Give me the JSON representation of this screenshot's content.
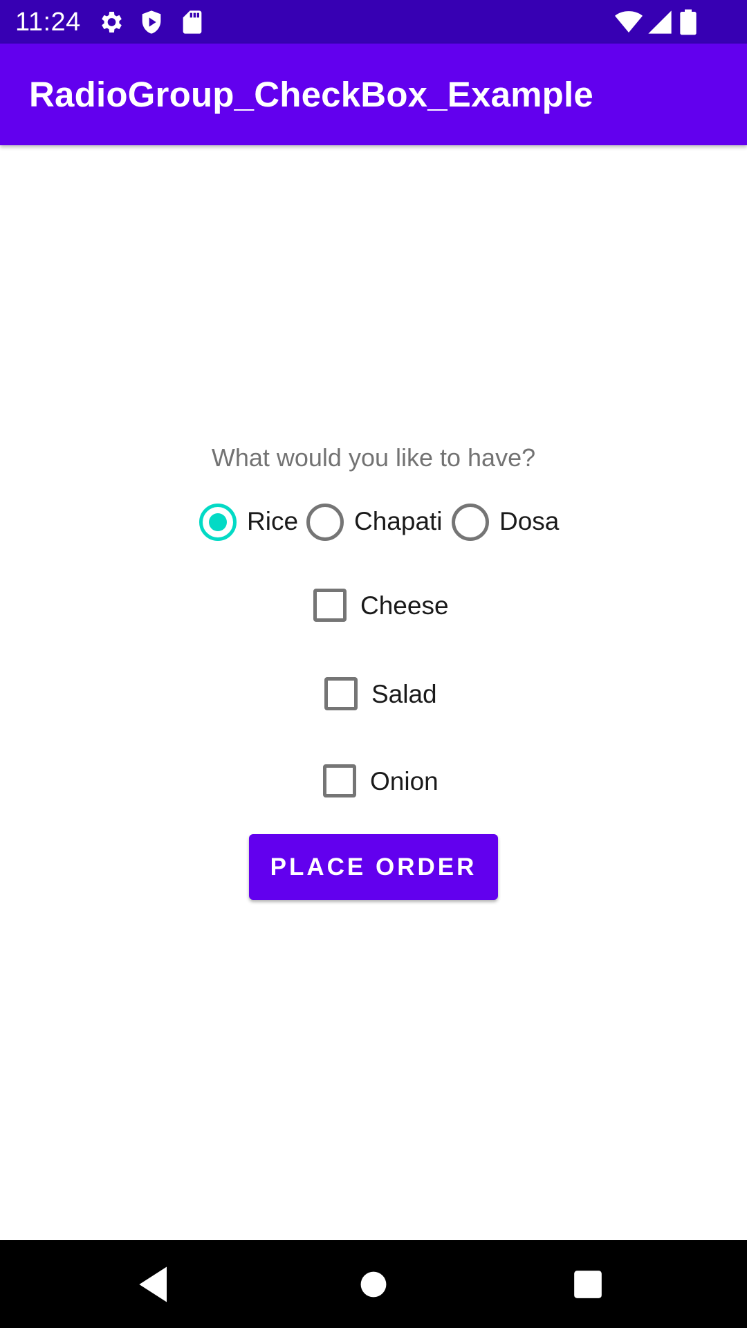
{
  "status_bar": {
    "time": "11:24",
    "icons": [
      "gear-icon",
      "shield-icon",
      "sd-card-icon",
      "wifi-icon",
      "signal-icon",
      "battery-icon"
    ]
  },
  "app_bar": {
    "title": "RadioGroup_CheckBox_Example"
  },
  "main": {
    "question": "What would you like to have?",
    "radio_options": [
      {
        "label": "Rice",
        "checked": true
      },
      {
        "label": "Chapati",
        "checked": false
      },
      {
        "label": "Dosa",
        "checked": false
      }
    ],
    "checkboxes": [
      {
        "label": "Cheese",
        "checked": false
      },
      {
        "label": "Salad",
        "checked": false
      },
      {
        "label": "Onion",
        "checked": false
      }
    ],
    "order_button": "PLACE ORDER"
  },
  "nav_bar": {
    "buttons": [
      "back-icon",
      "home-icon",
      "recents-icon"
    ]
  },
  "colors": {
    "status_bar": "#3700b3",
    "primary": "#6200ee",
    "accent": "#03dac5",
    "unchecked": "#757575"
  }
}
